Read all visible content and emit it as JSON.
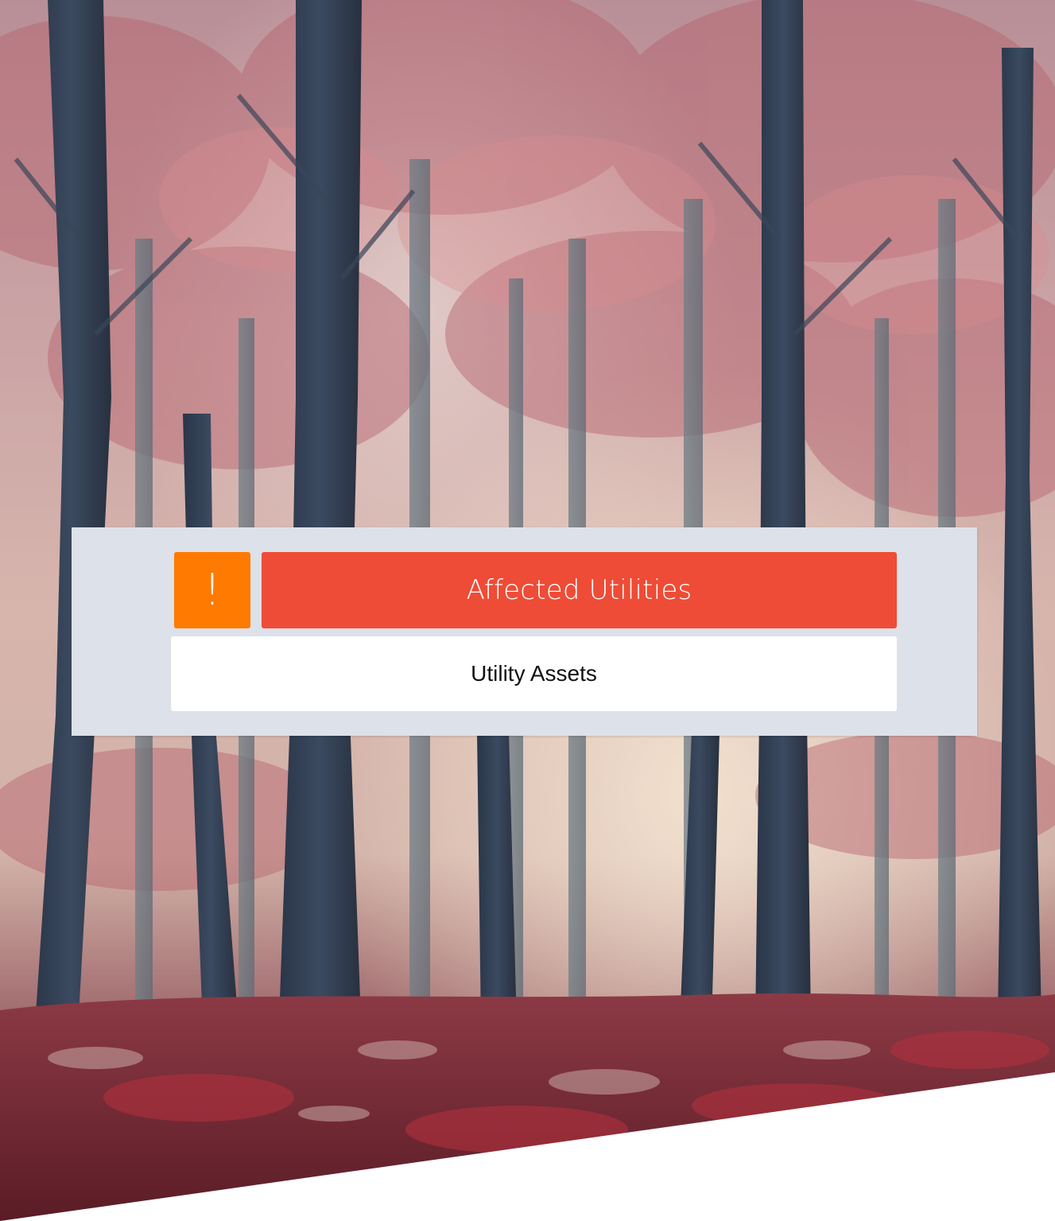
{
  "alert": {
    "symbol": "!",
    "icon": "exclamation-icon",
    "color": "#ff7a00"
  },
  "header": {
    "title": "Affected Utilities",
    "color": "#ee4c36"
  },
  "list": {
    "item_label": "Utility Assets"
  },
  "background": {
    "scene": "misty-red-autumn-forest",
    "panel_color": "#dde1ea"
  }
}
